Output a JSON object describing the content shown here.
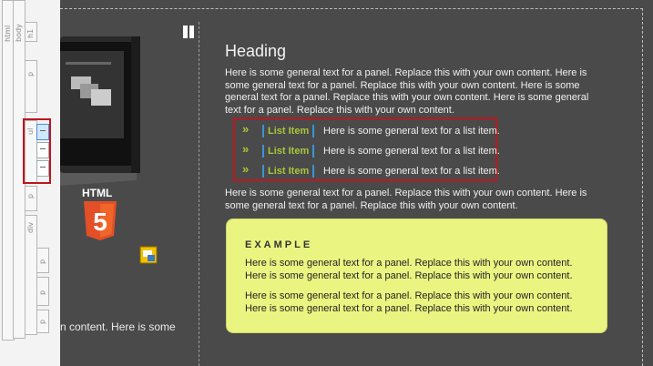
{
  "ruler": {
    "tags": [
      "html",
      "body",
      "h1",
      "p",
      "ul",
      "li",
      "li",
      "li",
      "p",
      "div",
      "p",
      "p",
      "p"
    ]
  },
  "main": {
    "heading": "Heading",
    "paragraph1": "Here is some general text for a panel. Replace this with your own content. Here is some general text for a panel. Replace this with your own content. Here is some general text for a panel. Replace this with your own content. Here is some general text for a panel. Replace this with your own content.",
    "list": [
      {
        "label": "List Item",
        "text": "Here is some general text for a list item."
      },
      {
        "label": "List Item",
        "text": "Here is some general text for a list item."
      },
      {
        "label": "List Item",
        "text": "Here is some general text for a list item."
      }
    ],
    "paragraph2": "Here is some general text for a panel. Replace this with your own content. Here is some general text for a panel. Replace this with your own content."
  },
  "example": {
    "title": "EXAMPLE",
    "p1": "Here is some general text for a panel. Replace this with your own content. Here is some general text for a panel. Replace this with your own content.",
    "p2": "Here is some general text for a panel. Replace this with your own content. Here is some general text for a panel. Replace this with your own content."
  },
  "sidebar": {
    "logo_label": "HTML",
    "badge_glyph": "5",
    "cut_text": "n content. Here is some"
  },
  "colors": {
    "background": "#4a4a4a",
    "accent_green": "#a8c63a",
    "selection_red": "#c0161d",
    "example_bg": "#eaf481"
  }
}
